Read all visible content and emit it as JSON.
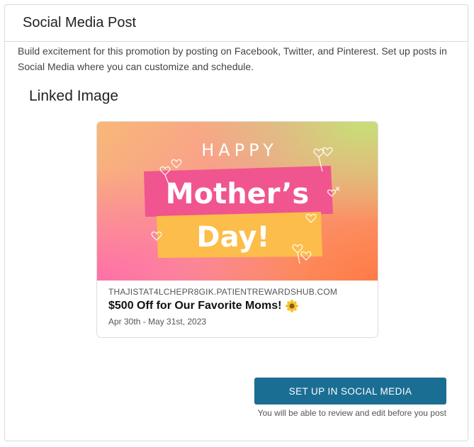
{
  "card": {
    "title": "Social Media Post",
    "description": "Build excitement for this promotion by posting on Facebook, Twitter, and Pinterest. Set up posts in Social Media where you can customize and schedule."
  },
  "linked_image": {
    "section_title": "Linked Image",
    "image": {
      "line1": "HAPPY",
      "line2": "Mother’s",
      "line3": "Day!",
      "colors": {
        "pink_band": "#f0558f",
        "yellow_band": "#fdbd4a",
        "text": "#ffffff"
      }
    },
    "domain": "THAJISTAT4LCHEPR8GIK.PATIENTREWARDSHUB.COM",
    "title": "$500 Off for Our Favorite Moms!",
    "title_icon": "sunflower-icon",
    "dates": "Apr 30th - May 31st, 2023"
  },
  "actions": {
    "button_label": "SET UP IN SOCIAL MEDIA",
    "button_color": "#1b6e93",
    "note": "You will be able to review and edit before you post"
  }
}
